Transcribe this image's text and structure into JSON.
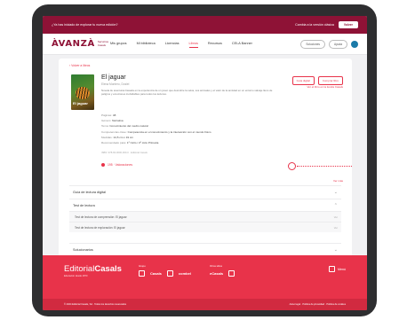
{
  "promo": {
    "text": "¿Ya has iniciado de explorar tu nueva edición?",
    "right_text": "Cambia a la versión clásica",
    "button": "Volver"
  },
  "header": {
    "logo": "ÀVANZÀ",
    "logo_sub": "Servicios Casals",
    "nav": [
      "Mis grupos",
      "Mi biblioteca",
      "Licencias",
      "Libros",
      "Recursos",
      "CELA Banner"
    ],
    "active_index": 3,
    "pill1": "Soluciones",
    "pill2": "Ayuda"
  },
  "book": {
    "back": "‹ Volver a libros",
    "cover_title": "El jaguar",
    "title": "El jaguar",
    "author": "Elena Montero, Dosiel",
    "description": "Novela de aventuras basada en la experiencia de un joven que descubre la selva, sus animales y el valor de la amistad en un entorno salvaje lleno de peligros y emociones inolvidables para todos los lectores.",
    "meta": [
      {
        "k": "Páginas:",
        "v": "48"
      },
      {
        "k": "Género:",
        "v": "Narrativa"
      },
      {
        "k": "Tema:",
        "v": "Conocimiento del medio natural"
      },
      {
        "k": "Competencias clave:",
        "v": "Competencia en el conocimiento y la interacción con el mundo físico"
      },
      {
        "k": "Medidas:",
        "v": "14,5 cm x 19 cm"
      },
      {
        "k": "Recomendado para:",
        "v": "1º Ciclo / 2º ciclo Primaria"
      }
    ],
    "note": "ISBN: 978-84-0000-000-0 · Editorial Casals",
    "likes": "195 · Valoraciones",
    "btn_guide": "Guía digital",
    "btn_buy": "Comprar libro",
    "side_note": "Ver el libro en la tienda Casals"
  },
  "view_all": "Ver más",
  "accordion": {
    "sections": [
      "Guía de lectura digital",
      "Test de lectura",
      "Solucionarios"
    ],
    "rows": [
      {
        "label": "Test de lectura de comprensión: El jaguar",
        "tag": "Ver"
      },
      {
        "label": "Test de lectura de exploración: El jaguar",
        "tag": "Ver"
      }
    ]
  },
  "footer": {
    "logo_a": "Editorial",
    "logo_b": "Casals",
    "logo_sub": "Educación desde 1870",
    "group1_label": "Grupo",
    "brand1": "Casals",
    "brand2": "combel",
    "group2_label": "Otros sitios",
    "brand3": "eCasals",
    "right": "Menú",
    "bottom_left": "© 2024 Editorial Casals, SA · Todos los derechos reservados",
    "bottom_right": "Aviso legal · Política de privacidad · Política de cookies"
  }
}
